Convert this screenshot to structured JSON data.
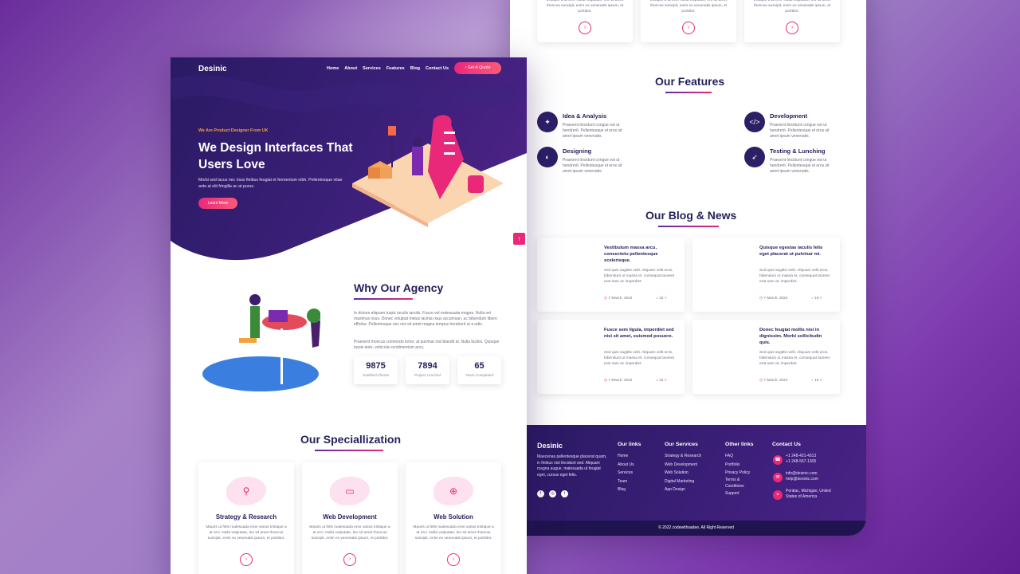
{
  "left": {
    "brand": "Desinic",
    "nav": [
      "Home",
      "About",
      "Services",
      "Features",
      "Blog",
      "Contact Us"
    ],
    "quote_button": "Get A Quote",
    "hero": {
      "subtitle": "We Are Product Designer From UK",
      "title": "We Design Interfaces That Users Love",
      "text": "Morbi sed lacus nec risus finibus feugiat et fermentum nibh. Pellentesque vitae ante at elit fringilla ac at purus.",
      "button": "Learn More"
    },
    "agency": {
      "title": "Why Our Agency",
      "para1": "In dictum aliquam turpis iaculis iaculis. Fusce vel malesuada magna. Nulla vel maximus risus. Donec volutpat metus lacinia risus accumsan, ac bibendum libero efficitur. Pellentesque nec nisl sit amet magna tempus hendrerit ut a odio.",
      "para2": "Praesent rhoncus commodo tortor, at pulvinar nisl blandit at. Nulla facilisi. Quisque turpis ante, vehicula condimentum arcu.",
      "stats": [
        {
          "value": "9875",
          "label": "Satisfied Clients"
        },
        {
          "value": "7894",
          "label": "Project Lunched"
        },
        {
          "value": "65",
          "label": "Years Completed"
        }
      ]
    },
    "specialization": {
      "title": "Our Speciallization",
      "cards": [
        {
          "title": "Strategy & Research",
          "icon": "telescope-icon",
          "text": "Mauris ut felis malesuada eros varius tristique a at orci. Nulla vulputate, leo sit amet rhoncus suscipit, enim ex venenatis ipsum, et porttitor."
        },
        {
          "title": "Web Development",
          "icon": "monitor-icon",
          "text": "Mauris ut felis malesuada eros varius tristique a at orci. Nulla vulputate, leo sit amet rhoncus suscipit, enim ex venenatis ipsum, et porttitor."
        },
        {
          "title": "Web Solution",
          "icon": "globe-icon",
          "text": "Mauris ut felis malesuada eros varius tristique a at orci. Nulla vulputate, leo sit amet rhoncus suscipit, enim ex venenatis ipsum, et porttitor."
        }
      ]
    }
  },
  "right": {
    "top_cards_text": "tristique a at orci. Nulla vulputate, leo sit amet rhoncus suscipit, enim ex venenatis ipsum, et porttitor.",
    "features": {
      "title": "Our Features",
      "items": [
        {
          "title": "Idea & Analysis",
          "icon": "lightbulb-icon",
          "text": "Praesent tincidunt congue est ut hendrerit. Pellentesque et eros sit amet ipsum venenatis."
        },
        {
          "title": "Development",
          "icon": "code-icon",
          "text": "Praesent tincidunt congue est ut hendrerit. Pellentesque et eros sit amet ipsum venenatis."
        },
        {
          "title": "Designing",
          "icon": "palette-icon",
          "text": "Praesent tincidunt congue est ut hendrerit. Pellentesque et eros sit amet ipsum venenatis."
        },
        {
          "title": "Testing & Lunching",
          "icon": "rocket-icon",
          "text": "Praesent tincidunt congue est ut hendrerit. Pellentesque et eros sit amet ipsum venenatis."
        }
      ]
    },
    "blog": {
      "title": "Our Blog & News",
      "posts": [
        {
          "title": "Vestibulum massa arcu, consectetu pellentesque scelerisque.",
          "text": "Sed quis sagittis velit. Aliquam velit eros, bibendum ut massa et, consequat laoreet erat nam ac imperdiet.",
          "date": "7 March, 2022",
          "comments": "15"
        },
        {
          "title": "Quisque egestas iaculis felis eget placerat ut pulvinar mi.",
          "text": "Sed quis sagittis velit. Aliquam velit eros, bibendum ut massa et, consequat laoreet erat nam ac imperdiet.",
          "date": "7 March, 2022",
          "comments": "15"
        },
        {
          "title": "Fusce sem ligula, imperdiet sed nisi sit amet, euismod posuere.",
          "text": "Sed quis sagittis velit. Aliquam velit eros, bibendum ut massa et, consequat laoreet erat nam ac imperdiet.",
          "date": "7 March, 2022",
          "comments": "15"
        },
        {
          "title": "Donec feugiat mollis nisi in dignissim. Morbi sollicitudin quis.",
          "text": "Sed quis sagittis velit. Aliquam velit eros, bibendum ut massa et, consequat laoreet erat nam ac imperdiet.",
          "date": "7 March, 2022",
          "comments": "15"
        }
      ]
    },
    "footer": {
      "brand": "Desinic",
      "about": "Maecenas pellentesque placerat quam, in finibus nisl tincidunt sed. Aliquam magna augue, malesuada ut feugiat eget, cursus eget felis.",
      "our_links_title": "Our links",
      "our_links": [
        "Home",
        "About Us",
        "Services",
        "Team",
        "Blog"
      ],
      "services_title": "Our Services",
      "services": [
        "Strategy & Research",
        "Web Development",
        "Web Solution",
        "Digital Marketing",
        "App Design"
      ],
      "other_title": "Other links",
      "other": [
        "FAQ",
        "Portfolio",
        "Privacy Policy",
        "Terms &",
        "Conditions",
        "Support"
      ],
      "contact_title": "Contact Us",
      "phone1": "+1 248-421-4313",
      "phone2": "+1 248-567-1305",
      "email1": "info@desinic.com",
      "email2": "help@desinic.com",
      "address1": "Pontiac, Michigan, United",
      "address2": "States of America",
      "copyright": "© 2022 codewithsadee. All Right Reserved"
    }
  },
  "colors": {
    "accent": "#e9287a",
    "navy": "#25215c",
    "hero": "#2a1a63"
  }
}
